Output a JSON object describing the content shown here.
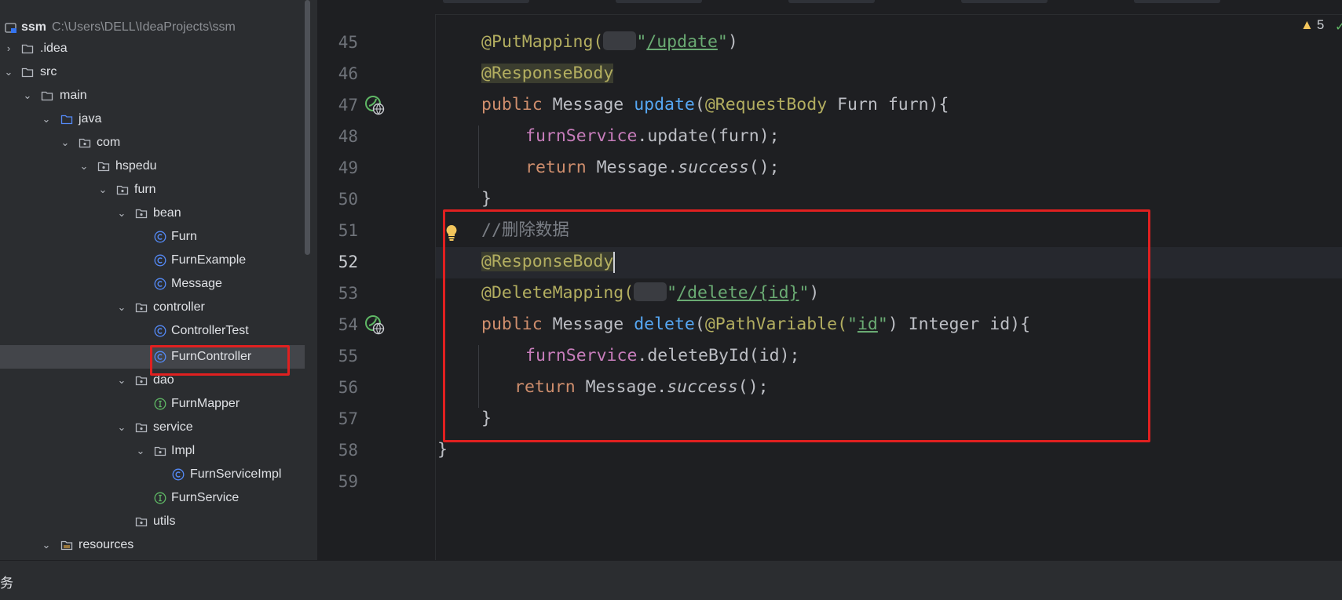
{
  "project": {
    "root_name": "ssm",
    "root_path": "C:\\Users\\DELL\\IdeaProjects\\ssm",
    "items": [
      {
        "label": ".idea",
        "kind": "folder"
      },
      {
        "label": "src",
        "kind": "folder"
      },
      {
        "label": "main",
        "kind": "folder"
      },
      {
        "label": "java",
        "kind": "source-folder"
      },
      {
        "label": "com",
        "kind": "package"
      },
      {
        "label": "hspedu",
        "kind": "package"
      },
      {
        "label": "furn",
        "kind": "package"
      },
      {
        "label": "bean",
        "kind": "package"
      },
      {
        "label": "Furn",
        "kind": "class"
      },
      {
        "label": "FurnExample",
        "kind": "class"
      },
      {
        "label": "Message",
        "kind": "class"
      },
      {
        "label": "controller",
        "kind": "package"
      },
      {
        "label": "ControllerTest",
        "kind": "class"
      },
      {
        "label": "FurnController",
        "kind": "class"
      },
      {
        "label": "dao",
        "kind": "package"
      },
      {
        "label": "FurnMapper",
        "kind": "interface"
      },
      {
        "label": "service",
        "kind": "package"
      },
      {
        "label": "Impl",
        "kind": "package"
      },
      {
        "label": "FurnServiceImpl",
        "kind": "class"
      },
      {
        "label": "FurnService",
        "kind": "interface"
      },
      {
        "label": "utils",
        "kind": "package"
      },
      {
        "label": "resources",
        "kind": "resource-folder"
      }
    ]
  },
  "editor": {
    "warnings_count": "5",
    "line_numbers": [
      "45",
      "46",
      "47",
      "48",
      "49",
      "50",
      "51",
      "52",
      "53",
      "54",
      "55",
      "56",
      "57",
      "58",
      "59"
    ],
    "active_line": "52",
    "tokens": {
      "put_mapping": "@PutMapping(",
      "update_path": "/update",
      "quote": "\"",
      "close_paren": ")",
      "response_body": "@ResponseBody",
      "public": "public",
      "message_type": "Message",
      "update_fn": "update",
      "request_body": "@RequestBody",
      "update_params": " Furn furn){",
      "furn_service": "furnService",
      "update_call": ".update(furn);",
      "return": "return",
      "message_dot": "Message.",
      "success": "success",
      "success_tail": "();",
      "close_brace": "}",
      "comment_delete": "//删除数据",
      "delete_mapping": "@DeleteMapping(",
      "delete_path": "/delete/{id}",
      "delete_fn": "delete",
      "path_variable": "@PathVariable(",
      "id_literal": "id",
      "delete_params": ") Integer id){",
      "delete_call": ".deleteById(id);"
    }
  },
  "bottom_bar": {
    "text": "务"
  },
  "colors": {
    "keyword": "#cf8e6d",
    "annotation": "#b3ae60",
    "string": "#6aab73",
    "function": "#56a8f5",
    "field": "#c77dbb",
    "comment": "#7a7e85",
    "highlight_box": "#e02020"
  }
}
